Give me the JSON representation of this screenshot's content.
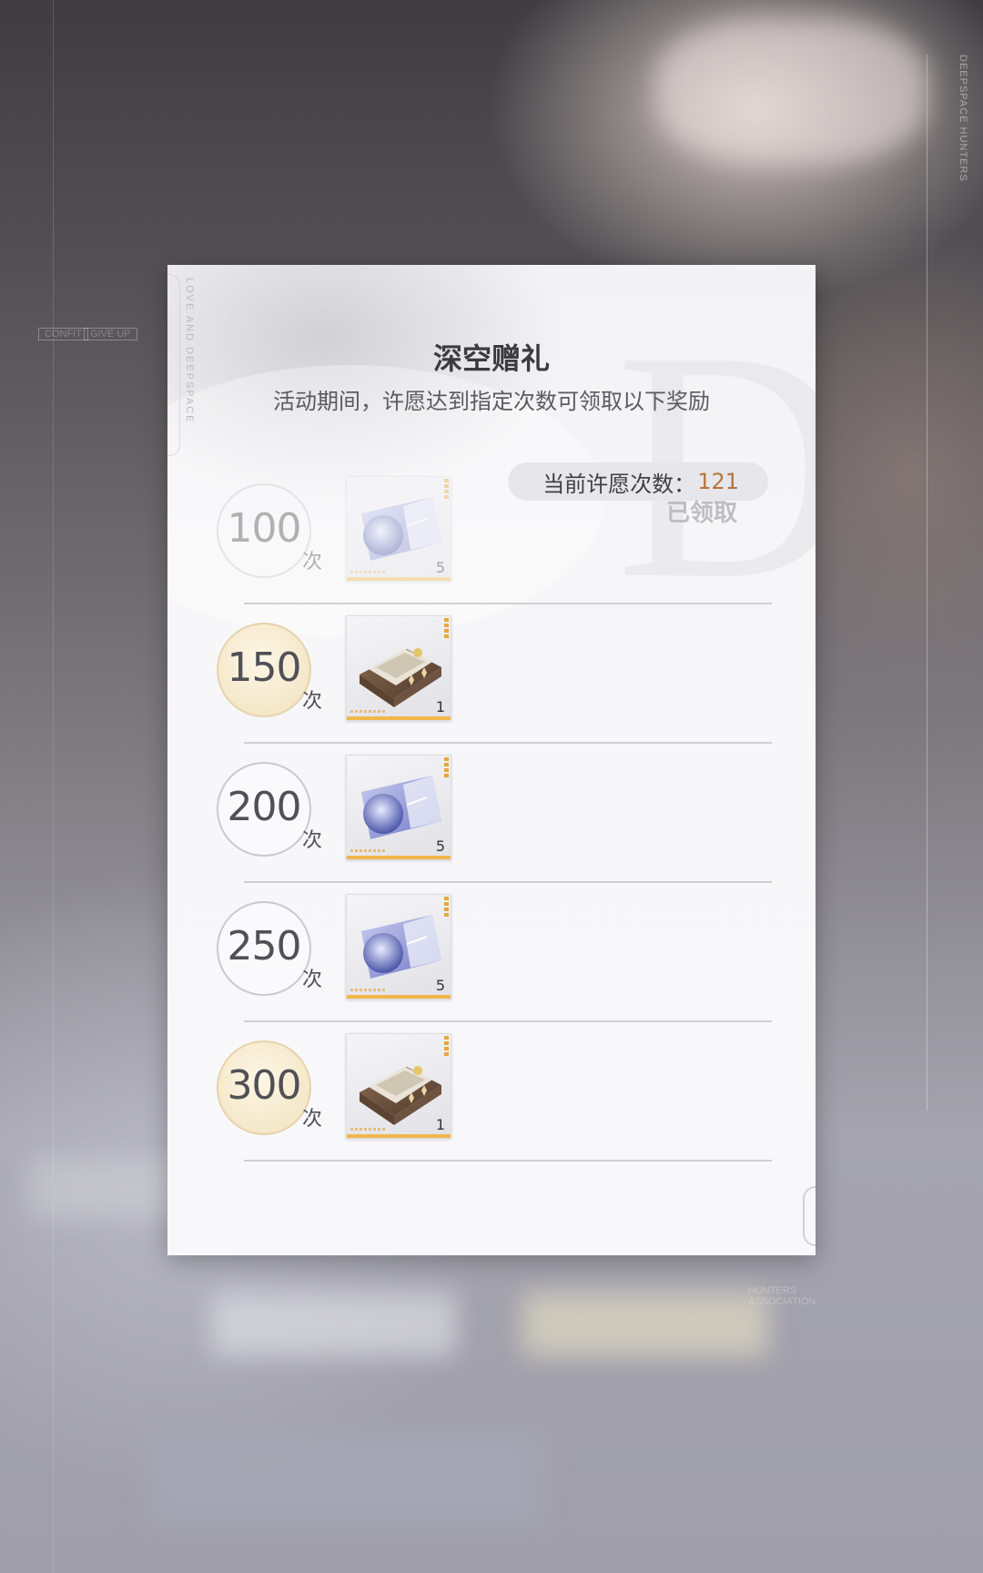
{
  "dialog": {
    "title": "深空赠礼",
    "subtitle": "活动期间，许愿达到指定次数可领取以下奖励",
    "count_label": "当前许愿次数：",
    "count_value": "121",
    "side_text": "LOVE AND DEEPSPACE"
  },
  "background": {
    "brand_label": "DEEPSPACE",
    "brand_sub": "HUNTERS",
    "association_label": "HUNTERS ASSOCIATION",
    "ghost_tags": [
      "CONFIT",
      "GIVE UP"
    ]
  },
  "rewards": [
    {
      "threshold": "100",
      "unit": "次",
      "item": "ticket-icon",
      "quantity": "5",
      "status": "已领取",
      "claimed": true,
      "badge_style": "silver"
    },
    {
      "threshold": "150",
      "unit": "次",
      "item": "box-icon",
      "quantity": "1",
      "status": "",
      "claimed": false,
      "badge_style": "gold"
    },
    {
      "threshold": "200",
      "unit": "次",
      "item": "ticket-icon",
      "quantity": "5",
      "status": "",
      "claimed": false,
      "badge_style": "silver"
    },
    {
      "threshold": "250",
      "unit": "次",
      "item": "ticket-icon",
      "quantity": "5",
      "status": "",
      "claimed": false,
      "badge_style": "silver"
    },
    {
      "threshold": "300",
      "unit": "次",
      "item": "box-icon",
      "quantity": "1",
      "status": "",
      "claimed": false,
      "badge_style": "gold"
    }
  ]
}
